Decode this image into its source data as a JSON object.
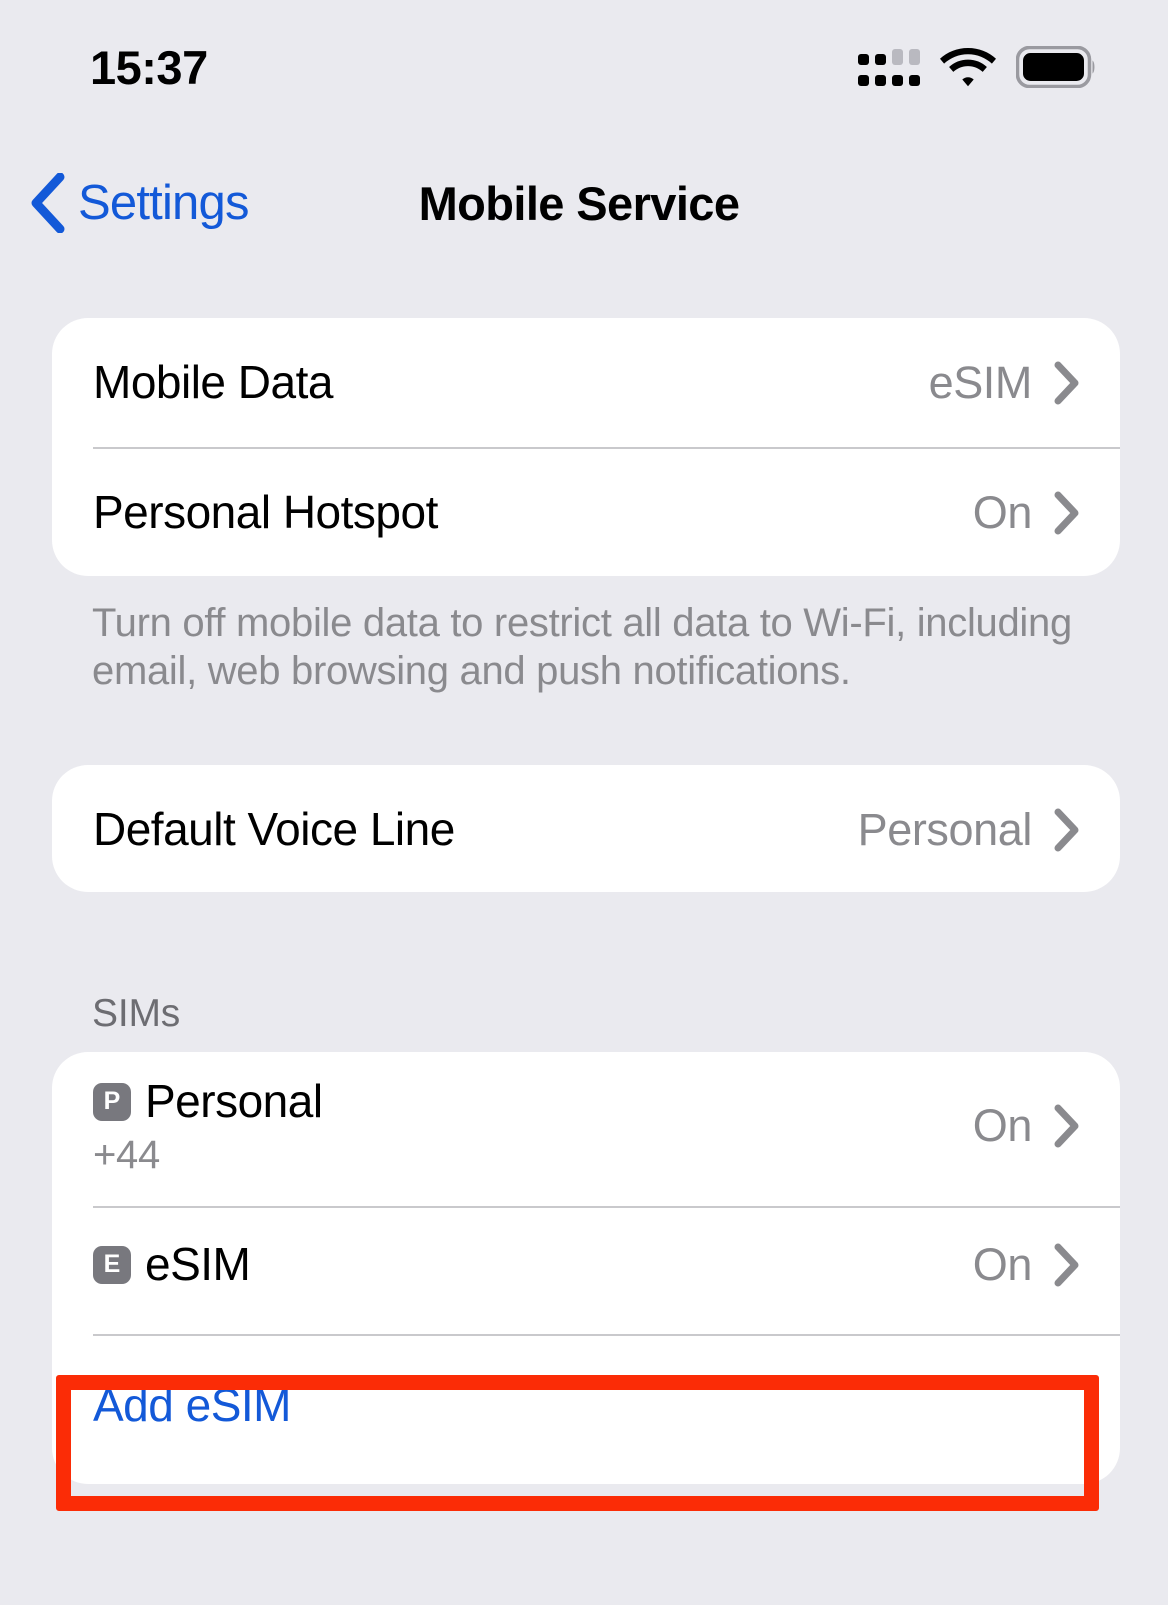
{
  "status_bar": {
    "time": "15:37",
    "icons": {
      "cellular": "cellular-signal-icon",
      "wifi": "wifi-icon",
      "battery": "battery-full-icon"
    }
  },
  "nav": {
    "back_label": "Settings",
    "back_icon": "chevron-left-icon",
    "title": "Mobile Service"
  },
  "colors": {
    "background": "#eaeaef",
    "card": "#ffffff",
    "accent_blue": "#1359d8",
    "secondary_text": "#8a8a8e",
    "highlight_red": "#fb2c06",
    "badge_grey": "#78787e"
  },
  "sections": {
    "data": {
      "rows": [
        {
          "label": "Mobile Data",
          "value": "eSIM",
          "accessory": "chevron-right-icon"
        },
        {
          "label": "Personal Hotspot",
          "value": "On",
          "accessory": "chevron-right-icon"
        }
      ],
      "footer": "Turn off mobile data to restrict all data to Wi-Fi, including email, web browsing and push notifications."
    },
    "voice": {
      "rows": [
        {
          "label": "Default Voice Line",
          "value": "Personal",
          "accessory": "chevron-right-icon"
        }
      ]
    },
    "sims": {
      "header": "SIMs",
      "rows": [
        {
          "badge": "P",
          "label": "Personal",
          "sub": "+44",
          "value": "On",
          "accessory": "chevron-right-icon"
        },
        {
          "badge": "E",
          "label": "eSIM",
          "sub": "",
          "value": "On",
          "accessory": "chevron-right-icon"
        }
      ],
      "add_action": "Add eSIM"
    }
  }
}
